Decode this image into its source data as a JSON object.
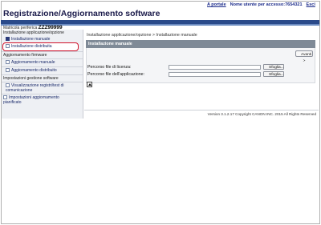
{
  "header": {
    "portal_link": "A portale",
    "user_label": "Nome utente per accesso:",
    "user_value": "7654321",
    "logout": "Esci"
  },
  "app": {
    "title": "Registrazione/Aggiornamento software",
    "device_label": "Matricola periferica",
    "device_value": "ZZZ99999"
  },
  "sidebar": {
    "categories": [
      {
        "label": "Installazione applicazione/opzione",
        "items": [
          {
            "label": "Installazione manuale",
            "selected": true
          },
          {
            "label": "Installazione distribuita",
            "selected": false,
            "highlighted": true
          }
        ]
      },
      {
        "label": "Aggiornamento firmware",
        "items": [
          {
            "label": "Aggiornamento manuale"
          },
          {
            "label": "Aggiornamento distribuito"
          }
        ]
      },
      {
        "label": "Impostazioni gestione software",
        "items": [
          {
            "label": "Visualizzazione registri/test di comunicazione"
          },
          {
            "label": "Impostazioni aggiornamento pianificato"
          }
        ]
      }
    ]
  },
  "main": {
    "breadcrumb": "Installazione applicazione/opzione > Installazione manuale",
    "section_title": "Installazione manuale",
    "next_button": "Avanti >",
    "fields": [
      {
        "label": "Percorso file di licenza:",
        "value": "",
        "browse": "Sfoglia..."
      },
      {
        "label": "Percorso file dell'applicazione:",
        "value": "",
        "browse": "Sfoglia..."
      }
    ]
  },
  "footer": {
    "version": "Version 3.1.2.17 Copyright CANON INC. 2015 All Rights Reserved"
  },
  "colors": {
    "title_bar": "#2a4a8a",
    "section_header": "#7f8a97",
    "highlight": "#d0102a",
    "link": "#1a2a8a"
  }
}
